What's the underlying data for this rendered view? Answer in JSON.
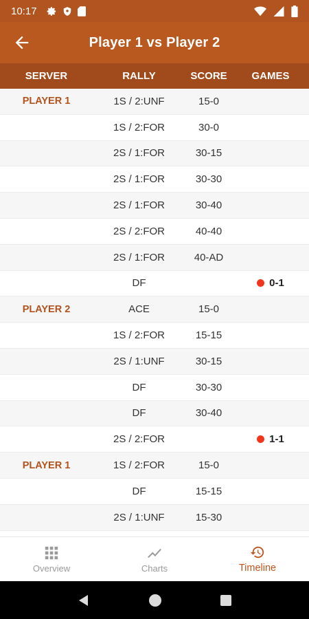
{
  "status_bar": {
    "time": "10:17"
  },
  "app_bar": {
    "title": "Player 1 vs Player 2"
  },
  "table": {
    "headers": {
      "server": "SERVER",
      "rally": "RALLY",
      "score": "SCORE",
      "games": "GAMES"
    },
    "rows": [
      {
        "server": "PLAYER 1",
        "rally": "1S / 2:UNF",
        "score": "15-0",
        "games": ""
      },
      {
        "server": "",
        "rally": "1S / 2:FOR",
        "score": "30-0",
        "games": ""
      },
      {
        "server": "",
        "rally": "2S / 1:FOR",
        "score": "30-15",
        "games": ""
      },
      {
        "server": "",
        "rally": "2S / 1:FOR",
        "score": "30-30",
        "games": ""
      },
      {
        "server": "",
        "rally": "2S / 1:FOR",
        "score": "30-40",
        "games": ""
      },
      {
        "server": "",
        "rally": "2S / 2:FOR",
        "score": "40-40",
        "games": ""
      },
      {
        "server": "",
        "rally": "2S / 1:FOR",
        "score": "40-AD",
        "games": ""
      },
      {
        "server": "",
        "rally": "DF",
        "score": "",
        "games": "0-1"
      },
      {
        "server": "PLAYER 2",
        "rally": "ACE",
        "score": "15-0",
        "games": ""
      },
      {
        "server": "",
        "rally": "1S / 2:FOR",
        "score": "15-15",
        "games": ""
      },
      {
        "server": "",
        "rally": "2S / 1:UNF",
        "score": "30-15",
        "games": ""
      },
      {
        "server": "",
        "rally": "DF",
        "score": "30-30",
        "games": ""
      },
      {
        "server": "",
        "rally": "DF",
        "score": "30-40",
        "games": ""
      },
      {
        "server": "",
        "rally": "2S / 2:FOR",
        "score": "",
        "games": "1-1"
      },
      {
        "server": "PLAYER 1",
        "rally": "1S / 2:FOR",
        "score": "15-0",
        "games": ""
      },
      {
        "server": "",
        "rally": "DF",
        "score": "15-15",
        "games": ""
      },
      {
        "server": "",
        "rally": "2S / 1:UNF",
        "score": "15-30",
        "games": ""
      }
    ]
  },
  "bottom_nav": {
    "items": [
      {
        "label": "Overview",
        "icon": "grid-icon",
        "active": false
      },
      {
        "label": "Charts",
        "icon": "chart-line-icon",
        "active": false
      },
      {
        "label": "Timeline",
        "icon": "history-icon",
        "active": true
      }
    ]
  },
  "colors": {
    "app_bar": "#b9581f",
    "header_bar": "#a14b1c",
    "accent": "#c0541c",
    "game_dot": "#f2351c"
  }
}
